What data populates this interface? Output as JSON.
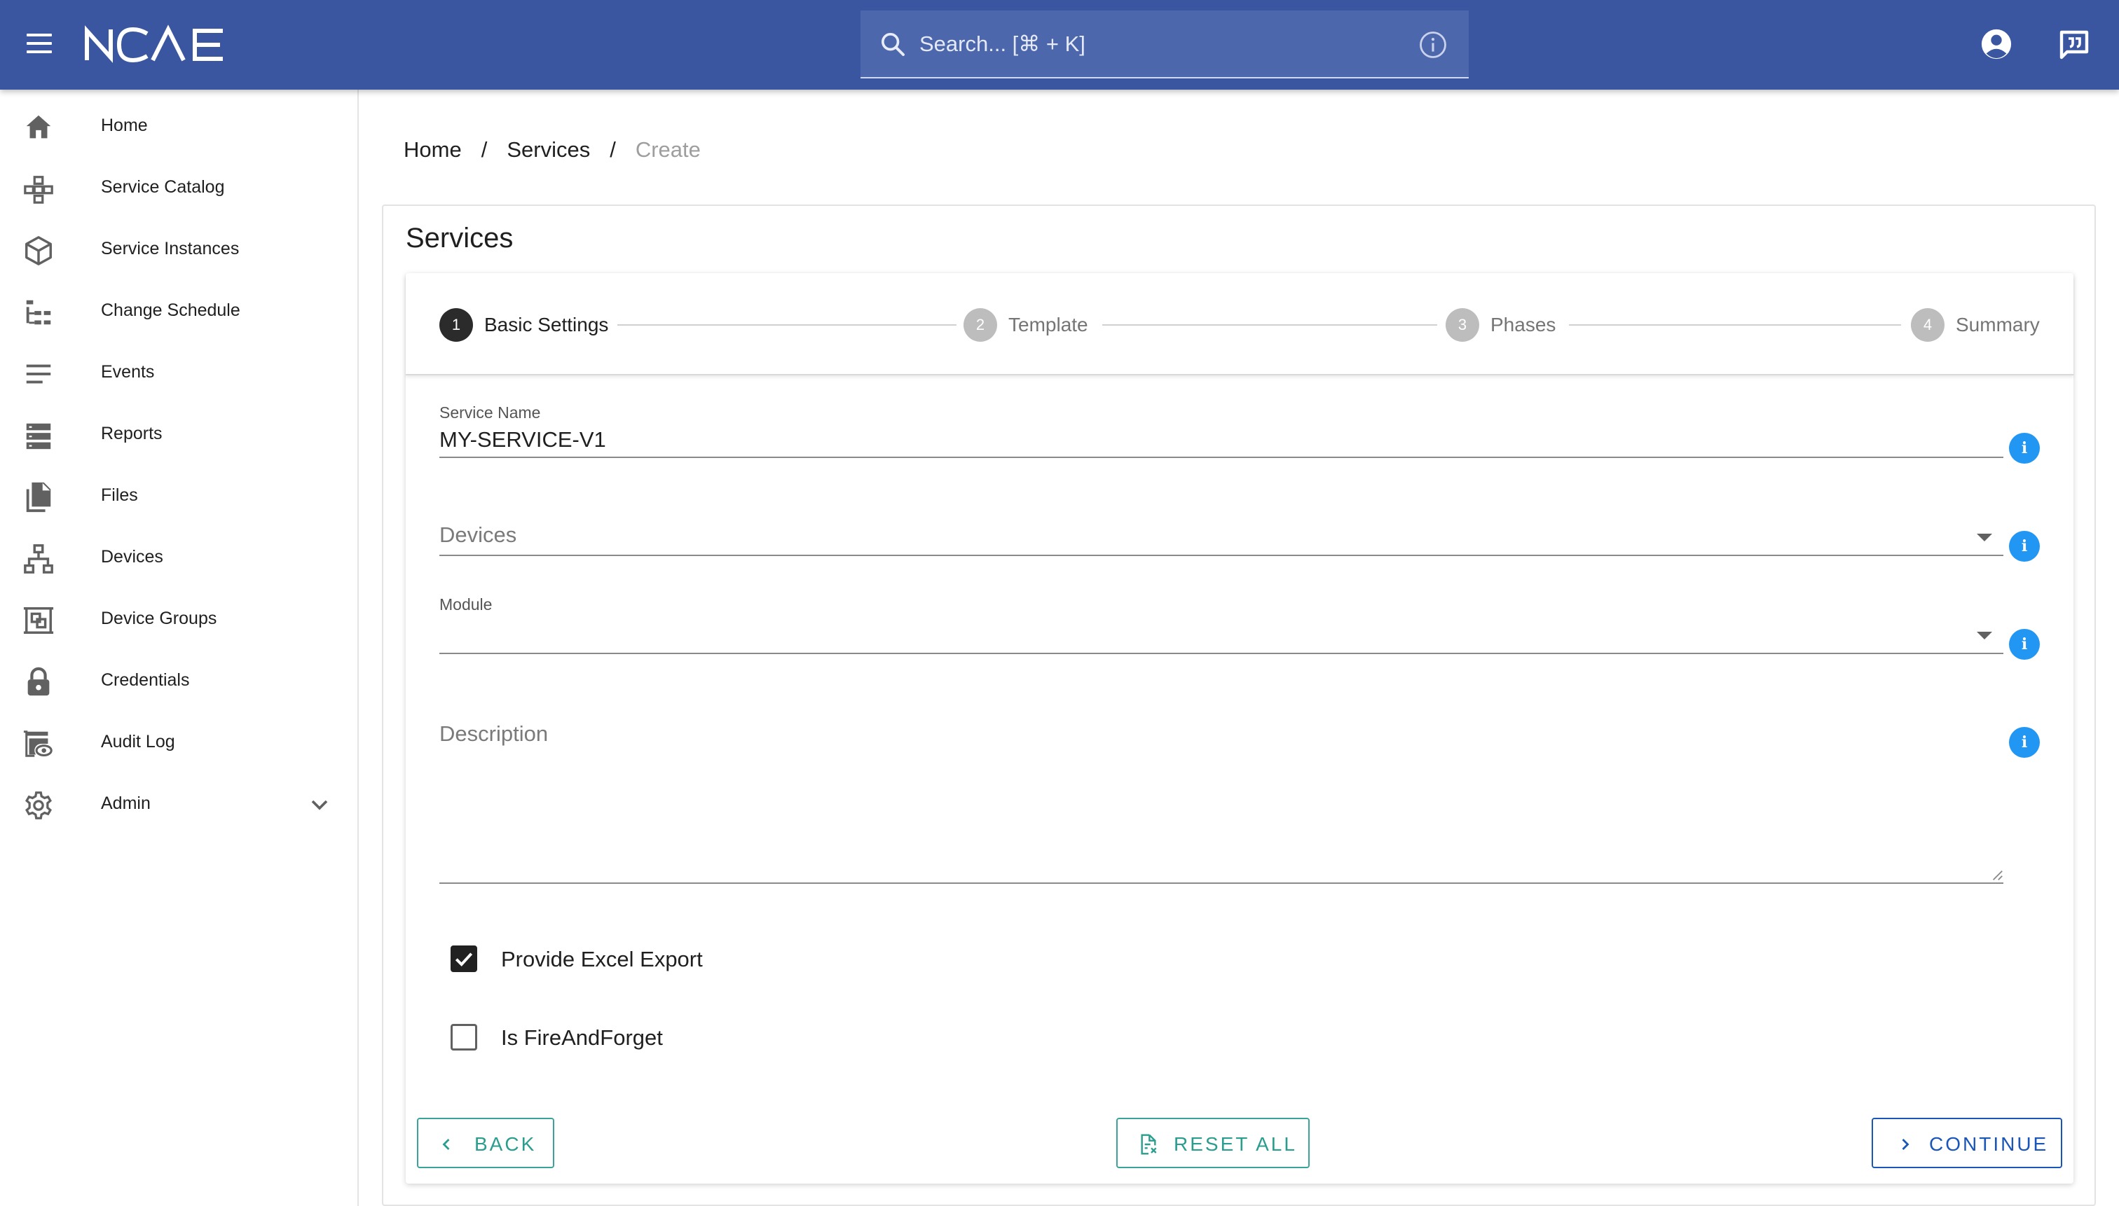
{
  "header": {
    "logo_text": "NCAE",
    "search_placeholder": "Search... [⌘ + K]"
  },
  "sidebar": {
    "items": [
      {
        "label": "Home",
        "icon": "home-icon"
      },
      {
        "label": "Service Catalog",
        "icon": "catalog-icon"
      },
      {
        "label": "Service Instances",
        "icon": "cube-icon"
      },
      {
        "label": "Change Schedule",
        "icon": "schedule-tree-icon"
      },
      {
        "label": "Events",
        "icon": "lines-icon"
      },
      {
        "label": "Reports",
        "icon": "reports-icon"
      },
      {
        "label": "Files",
        "icon": "files-icon"
      },
      {
        "label": "Devices",
        "icon": "network-icon"
      },
      {
        "label": "Device Groups",
        "icon": "device-groups-icon"
      },
      {
        "label": "Credentials",
        "icon": "lock-icon"
      },
      {
        "label": "Audit Log",
        "icon": "audit-log-icon"
      },
      {
        "label": "Admin",
        "icon": "gear-icon"
      }
    ]
  },
  "breadcrumb": {
    "items": [
      "Home",
      "Services"
    ],
    "current": "Create",
    "separator": "/"
  },
  "card": {
    "title": "Services"
  },
  "stepper": {
    "steps": [
      {
        "number": "1",
        "label": "Basic Settings",
        "active": true
      },
      {
        "number": "2",
        "label": "Template",
        "active": false
      },
      {
        "number": "3",
        "label": "Phases",
        "active": false
      },
      {
        "number": "4",
        "label": "Summary",
        "active": false
      }
    ]
  },
  "form": {
    "service_name": {
      "label": "Service Name",
      "value": "MY-SERVICE-V1"
    },
    "devices": {
      "label": "Devices",
      "value": ""
    },
    "module": {
      "label": "Module",
      "value": ""
    },
    "description": {
      "label": "Description",
      "value": ""
    },
    "provide_excel_export": {
      "label": "Provide Excel Export",
      "checked": true
    },
    "is_fire_and_forget": {
      "label": "Is FireAndForget",
      "checked": false
    },
    "info_glyph": "i"
  },
  "actions": {
    "back": "BACK",
    "reset_all": "RESET ALL",
    "continue": "CONTINUE"
  },
  "colors": {
    "header_bg": "#3a56a0",
    "info_blue": "#2196f3",
    "teal_button": "#2a9d8f",
    "primary_button": "#1a56b8"
  }
}
